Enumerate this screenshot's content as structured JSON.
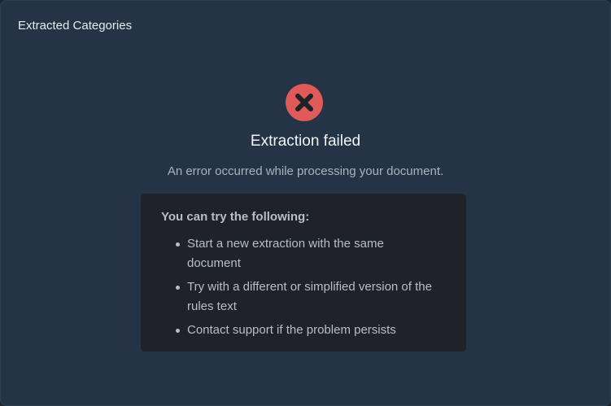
{
  "panel": {
    "title": "Extracted Categories"
  },
  "error": {
    "icon": "x-circle-icon",
    "icon_color": "#e05a5a",
    "title": "Extraction failed",
    "message": "An error occurred while processing your document."
  },
  "tips": {
    "heading": "You can try the following:",
    "items": [
      "Start a new extraction with the same document",
      "Try with a different or simplified version of the rules text",
      "Contact support if the problem persists"
    ]
  }
}
